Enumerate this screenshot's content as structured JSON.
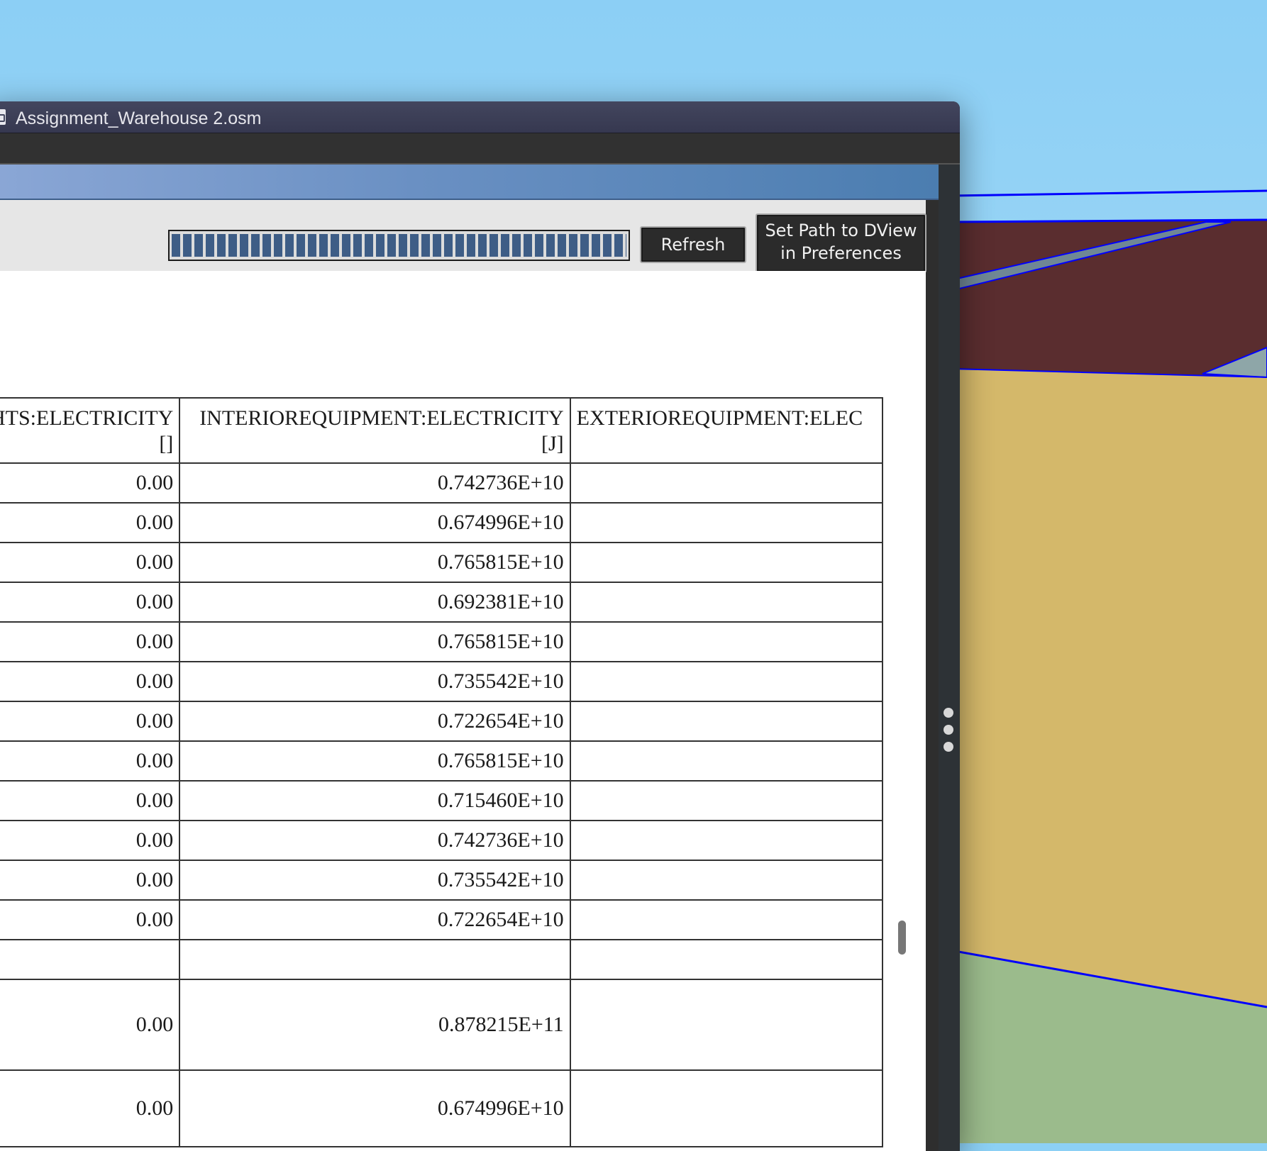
{
  "window": {
    "title": "Assignment_Warehouse 2.osm"
  },
  "controls": {
    "progress_percent": 100,
    "refresh_label": "Refresh",
    "dview_label_line1": "Set Path to DView",
    "dview_label_line2": "in Preferences"
  },
  "table": {
    "columns": [
      {
        "name": "GHTS:ELECTRICITY",
        "unit": "[]"
      },
      {
        "name": "INTERIOREQUIPMENT:ELECTRICITY",
        "unit": "[J]"
      },
      {
        "name": "EXTERIOREQUIPMENT:ELEC",
        "unit": ""
      }
    ],
    "rows": [
      [
        "0.00",
        "0.742736E+10",
        ""
      ],
      [
        "0.00",
        "0.674996E+10",
        ""
      ],
      [
        "0.00",
        "0.765815E+10",
        ""
      ],
      [
        "0.00",
        "0.692381E+10",
        ""
      ],
      [
        "0.00",
        "0.765815E+10",
        ""
      ],
      [
        "0.00",
        "0.735542E+10",
        ""
      ],
      [
        "0.00",
        "0.722654E+10",
        ""
      ],
      [
        "0.00",
        "0.765815E+10",
        ""
      ],
      [
        "0.00",
        "0.715460E+10",
        ""
      ],
      [
        "0.00",
        "0.742736E+10",
        ""
      ],
      [
        "0.00",
        "0.735542E+10",
        ""
      ],
      [
        "0.00",
        "0.722654E+10",
        ""
      ],
      [
        "",
        "",
        ""
      ],
      [
        "0.00",
        "0.878215E+11",
        ""
      ],
      [
        "0.00",
        "0.674996E+10",
        ""
      ]
    ]
  },
  "colors": {
    "sky": "#8cd0f5",
    "roof": "#5a2d2f",
    "wall": "#d4b86a",
    "ground": "#9bbb8c",
    "edge": "#0000ff"
  }
}
